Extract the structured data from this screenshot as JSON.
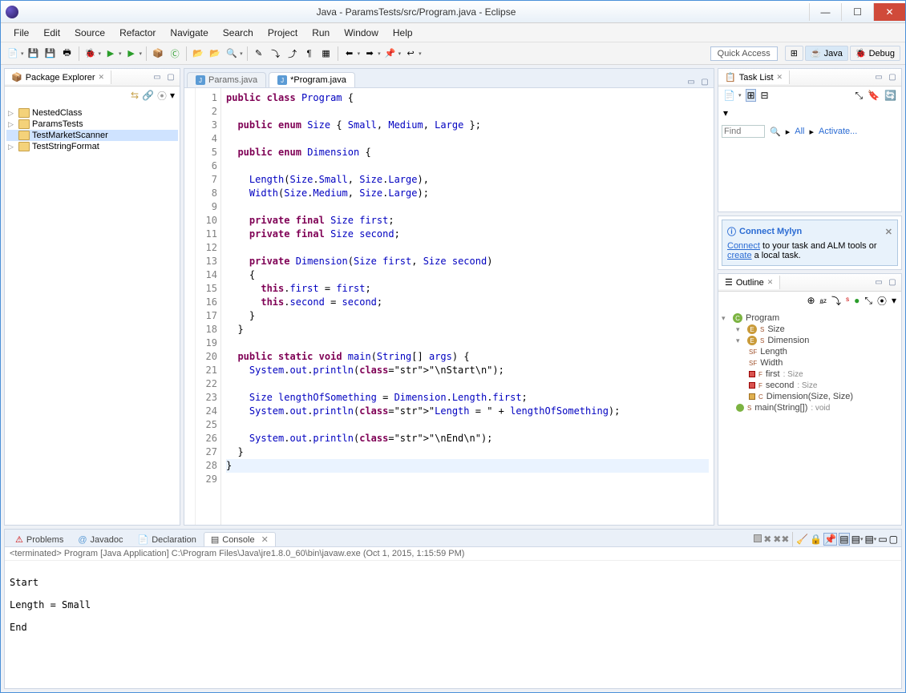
{
  "window": {
    "title": "Java - ParamsTests/src/Program.java - Eclipse"
  },
  "menu": [
    "File",
    "Edit",
    "Source",
    "Refactor",
    "Navigate",
    "Search",
    "Project",
    "Run",
    "Window",
    "Help"
  ],
  "quick_access": "Quick Access",
  "perspectives": {
    "java": "Java",
    "debug": "Debug"
  },
  "package_explorer": {
    "title": "Package Explorer",
    "projects": [
      "NestedClass",
      "ParamsTests",
      "TestMarketScanner",
      "TestStringFormat"
    ],
    "selected": "TestMarketScanner"
  },
  "editor_tabs": {
    "inactive": "Params.java",
    "active": "*Program.java"
  },
  "code_lines": [
    "public class Program {",
    "",
    "  public enum Size { Small, Medium, Large };",
    "",
    "  public enum Dimension {",
    "",
    "    Length(Size.Small, Size.Large),",
    "    Width(Size.Medium, Size.Large);",
    "",
    "    private final Size first;",
    "    private final Size second;",
    "",
    "    private Dimension(Size first, Size second)",
    "    {",
    "      this.first = first;",
    "      this.second = second;",
    "    }",
    "  }",
    "",
    "  public static void main(String[] args) {",
    "    System.out.println(\"\\nStart\\n\");",
    "",
    "    Size lengthOfSomething = Dimension.Length.first;",
    "    System.out.println(\"Length = \" + lengthOfSomething);",
    "",
    "    System.out.println(\"\\nEnd\\n\");",
    "  }",
    "}",
    ""
  ],
  "line_start": 1,
  "tasklist": {
    "title": "Task List",
    "find": "Find",
    "all": "All",
    "activate": "Activate..."
  },
  "mylyn": {
    "title": "Connect Mylyn",
    "text_1": " to your task and ALM tools or ",
    "link_connect": "Connect",
    "link_create": "create",
    "text_2": " a local task."
  },
  "outline": {
    "title": "Outline",
    "root": "Program",
    "items": [
      {
        "icon": "enum",
        "label": "Size"
      },
      {
        "icon": "enum",
        "label": "Dimension"
      },
      {
        "icon": "sf",
        "label": "Length",
        "indent": 1
      },
      {
        "icon": "sf",
        "label": "Width",
        "indent": 1
      },
      {
        "icon": "f",
        "label": "first",
        "type": ": Size",
        "indent": 1
      },
      {
        "icon": "f",
        "label": "second",
        "type": ": Size",
        "indent": 1
      },
      {
        "icon": "c",
        "label": "Dimension(Size, Size)",
        "indent": 1
      },
      {
        "icon": "m",
        "label": "main(String[])",
        "type": ": void"
      }
    ]
  },
  "bottom_tabs": [
    "Problems",
    "Javadoc",
    "Declaration",
    "Console"
  ],
  "console": {
    "info": "<terminated> Program [Java Application] C:\\Program Files\\Java\\jre1.8.0_60\\bin\\javaw.exe (Oct 1, 2015, 1:15:59 PM)",
    "output": "\nStart\n\nLength = Small\n\nEnd\n"
  }
}
